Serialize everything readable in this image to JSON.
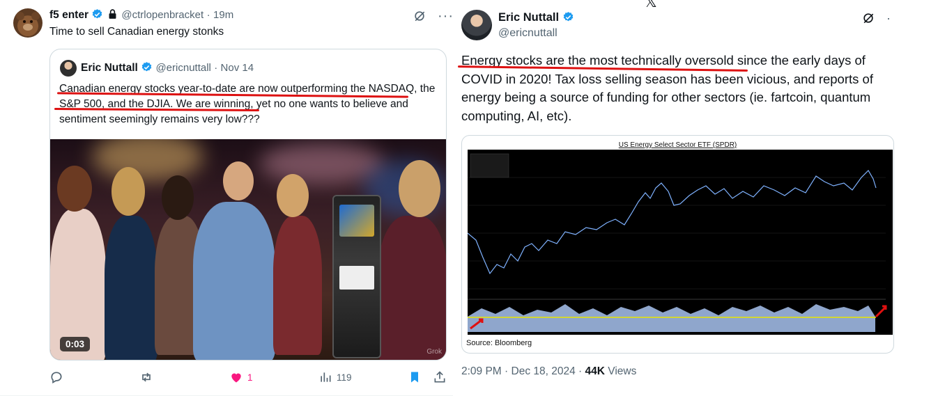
{
  "left_tweet": {
    "author_name": "f5 enter",
    "handle": "@ctrlopenbracket",
    "age": "19m",
    "text": "Time to sell Canadian energy stonks",
    "quoted": {
      "author_name": "Eric Nuttall",
      "handle": "@ericnuttall",
      "date": "Nov 14",
      "text": "Canadian energy stocks year-to-date are now outperforming the NASDAQ, the S&P 500, and the DJIA. We are winning, yet no one wants to believe and sentiment seemingly remains very low???",
      "video_time": "0:03",
      "watermark": "Grok"
    },
    "actions": {
      "replies": "",
      "reposts": "",
      "likes": "1",
      "views": "119"
    },
    "colors": {
      "like": "#f91880",
      "bookmark": "#1d9bf0",
      "underline": "#dd1111"
    }
  },
  "right_tweet": {
    "author_name": "Eric Nuttall",
    "handle": "@ericnuttall",
    "text": "Energy stocks are the most technically oversold since the early days of COVID in 2020! Tax loss selling season has been vicious, and reports of energy being a source of funding for other sectors (ie. fartcoin, quantum computing, AI, etc).",
    "chart": {
      "title": "US Energy Select Sector ETF (SPDR)",
      "source": "Source: Bloomberg"
    },
    "time": "2:09 PM",
    "date": "Dec 18, 2024",
    "views_count": "44K",
    "views_label": "Views"
  }
}
